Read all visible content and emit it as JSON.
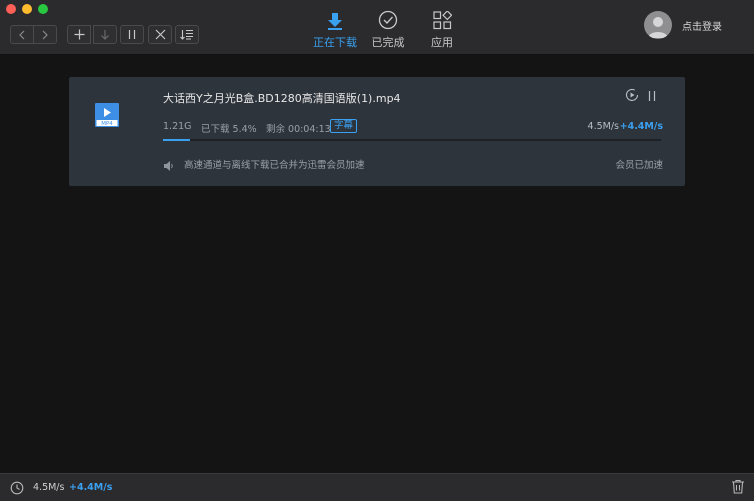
{
  "toolbar": {
    "tabs": [
      {
        "label": "正在下载",
        "icon": "download-arrow-icon",
        "active": true
      },
      {
        "label": "已完成",
        "icon": "check-circle-icon",
        "active": false
      },
      {
        "label": "应用",
        "icon": "apps-grid-icon",
        "active": false
      }
    ],
    "login_label": "点击登录"
  },
  "task": {
    "filename": "大话西Y之月光B盒.BD1280高清国语版(1).mp4",
    "file_type": "MP4",
    "size": "1.21G",
    "downloaded": "已下载 5.4%",
    "remaining": "剩余 00:04:13",
    "subtitle_badge": "字幕",
    "speed": "4.5M/s",
    "accel_speed": "+4.4M/s",
    "progress_percent": 5.4,
    "note": "高速通道与离线下载已合并为迅雷会员加速",
    "member_status": "会员已加速"
  },
  "status": {
    "speed": "4.5M/s",
    "accel_speed": "+4.4M/s"
  },
  "colors": {
    "accent": "#3aa0f0",
    "background": "#141414",
    "card": "#2e343c"
  }
}
